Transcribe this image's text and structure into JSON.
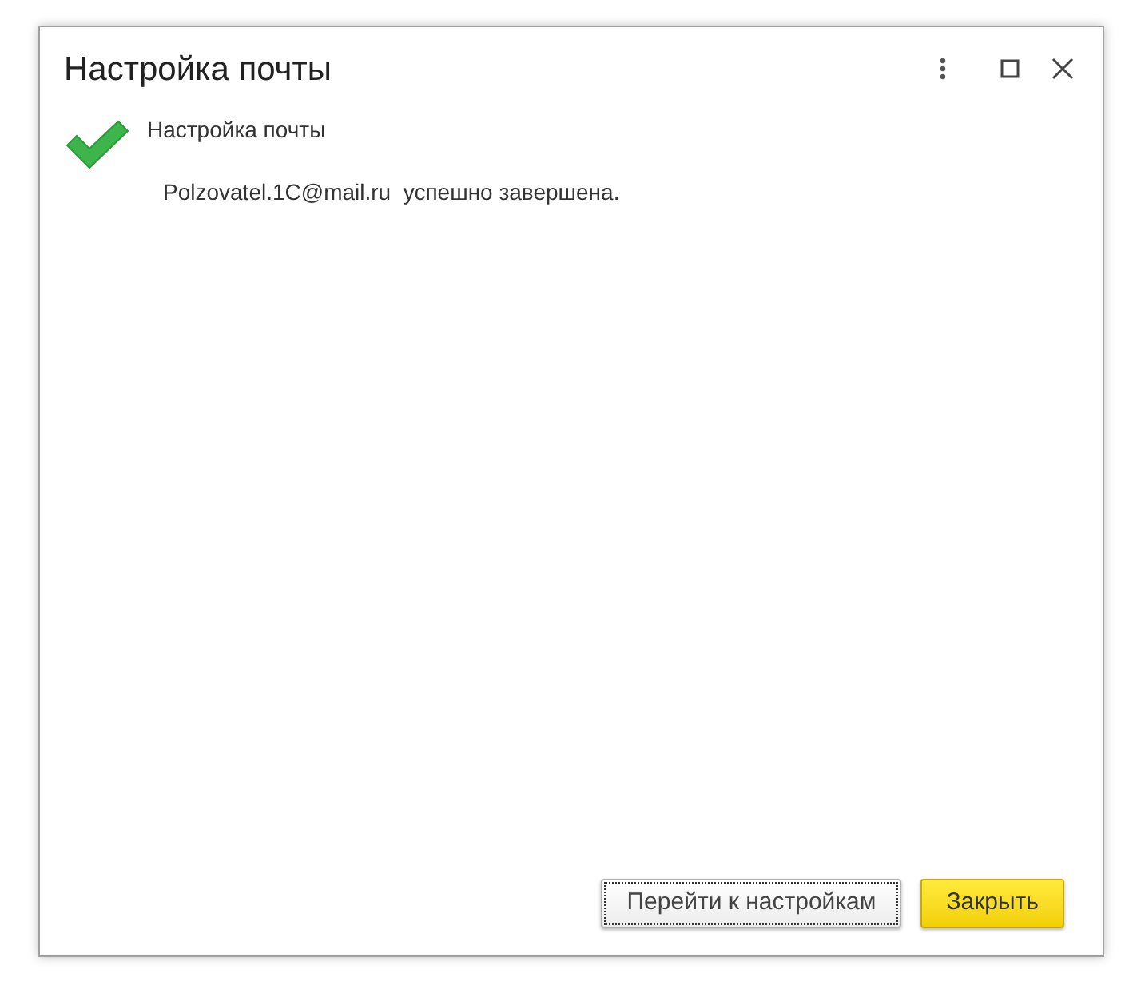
{
  "window": {
    "title": "Настройка почты"
  },
  "message": {
    "heading": "Настройка почты",
    "text": "Polzovatel.1C@mail.ru  успешно завершена."
  },
  "buttons": [
    {
      "label": "Перейти к настройкам",
      "kind": "normal",
      "focused": true
    },
    {
      "label": "Закрыть",
      "kind": "default",
      "focused": false
    }
  ]
}
